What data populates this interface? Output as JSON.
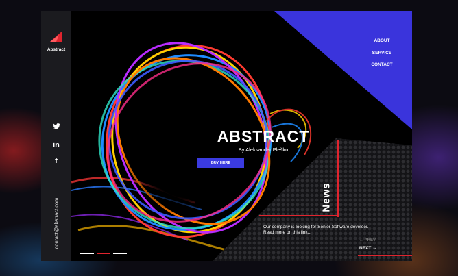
{
  "brand": {
    "logo_text": "Abstract"
  },
  "nav": {
    "items": [
      "ABOUT",
      "SERVICE",
      "CONTACT"
    ]
  },
  "social": [
    {
      "icon": "twitter-icon",
      "glyph": "🐦"
    },
    {
      "icon": "linkedin-icon",
      "glyph": "in"
    },
    {
      "icon": "facebook-icon",
      "glyph": "f"
    }
  ],
  "contact": {
    "email": "contact@abstract.com"
  },
  "hero": {
    "title": "ABSTRACT",
    "byline": "By Aleksandar Pleško",
    "button_label": "BUY HERE"
  },
  "news": {
    "title": "News",
    "text": "Our company is looking for Senior Software develoer. Read more on this link...",
    "prev_label": "← PREV",
    "next_label": "NEXT →"
  },
  "slider": {
    "active_index": 1,
    "count": 3
  },
  "colors": {
    "accent_blue": "#3a34dc",
    "accent_red": "#e0242e",
    "sidebar": "#1b1b1f"
  }
}
